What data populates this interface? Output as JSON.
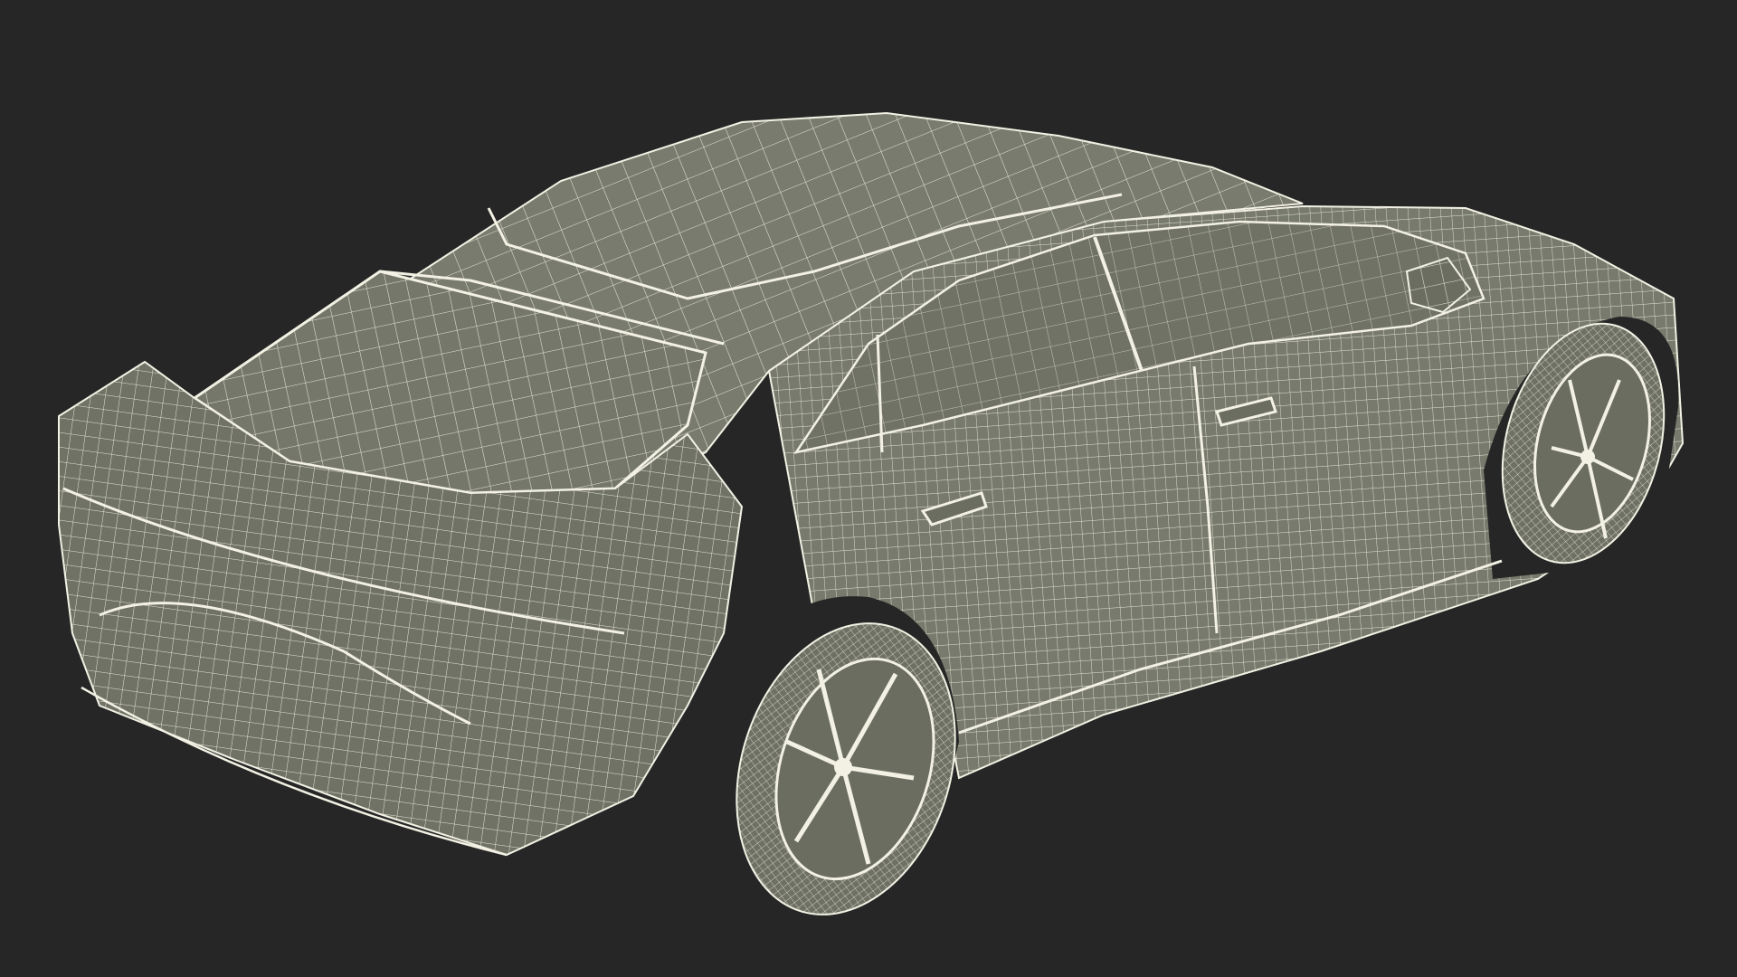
{
  "scene": {
    "subject": "car-wireframe-render",
    "colors": {
      "background": "#262626",
      "body_fill": "#777a6c",
      "body_shade": "#6a6d60",
      "body_dark": "#5d6055",
      "glass_fill": "#707266",
      "wire": "#f2f1e4",
      "tire": "#6e7064"
    },
    "view": "rear-three-quarter",
    "render_style": "wireframe-over-shaded"
  }
}
